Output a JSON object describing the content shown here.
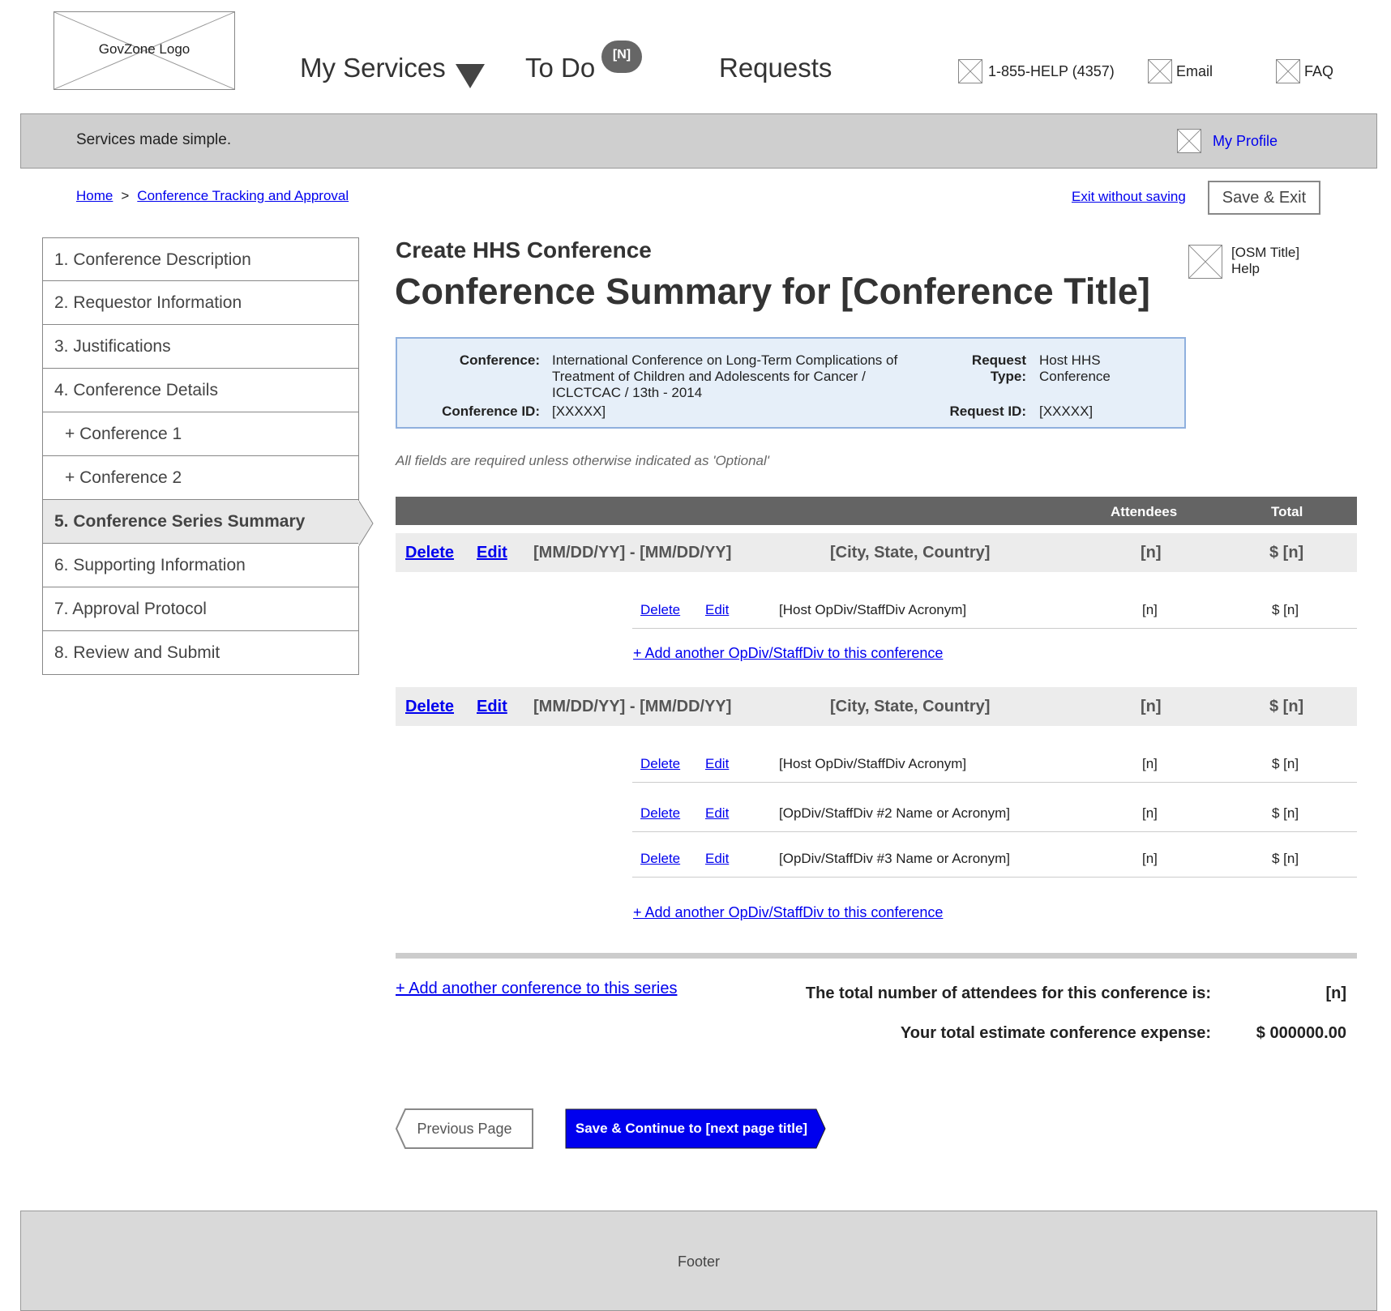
{
  "header": {
    "logo_text": "GovZone Logo",
    "nav": {
      "my_services": "My Services",
      "to_do": "To Do",
      "to_do_badge": "[N]",
      "requests": "Requests"
    },
    "utilities": {
      "phone": "1-855-HELP (4357)",
      "email": "Email",
      "faq": "FAQ"
    },
    "tagline": "Services made simple.",
    "my_profile": "My Profile"
  },
  "breadcrumb": {
    "home": "Home",
    "separator": ">",
    "current": "Conference Tracking and Approval"
  },
  "actions": {
    "exit_without_saving": "Exit without saving",
    "save_exit": "Save & Exit"
  },
  "sidebar": {
    "items": [
      {
        "label": "1. Conference Description"
      },
      {
        "label": "2. Requestor Information"
      },
      {
        "label": "3. Justifications"
      },
      {
        "label": "4. Conference Details"
      },
      {
        "label": "+ Conference 1"
      },
      {
        "label": "+ Conference 2"
      },
      {
        "label": "5. Conference Series Summary"
      },
      {
        "label": "6. Supporting Information"
      },
      {
        "label": "7. Approval Protocol"
      },
      {
        "label": "8. Review and Submit"
      }
    ]
  },
  "page": {
    "subtitle": "Create HHS Conference",
    "title": "Conference Summary for [Conference Title]",
    "help_line1": "[OSM Title]",
    "help_line2": "Help"
  },
  "info": {
    "conference_label": "Conference:",
    "conference_value": "International Conference on Long-Term Complications of Treatment of Children and Adolescents for Cancer / ICLCTCAC / 13th - 2014",
    "conference_id_label": "Conference ID:",
    "conference_id_value": "[XXXXX]",
    "request_type_label_1": "Request",
    "request_type_label_2": "Type:",
    "request_type_value_1": "Host HHS",
    "request_type_value_2": "Conference",
    "request_id_label": "Request ID:",
    "request_id_value": "[XXXXX]"
  },
  "note": "All fields are required unless otherwise indicated as 'Optional'",
  "table": {
    "col_attendees": "Attendees",
    "col_total": "Total",
    "delete": "Delete",
    "edit": "Edit",
    "conferences": [
      {
        "dates": "[MM/DD/YY] - [MM/DD/YY]",
        "location": "[City, State, Country]",
        "attendees": "[n]",
        "total": "$ [n]",
        "divisions": [
          {
            "name": "[Host OpDiv/StaffDiv Acronym]",
            "attendees": "[n]",
            "total": "$ [n]"
          }
        ]
      },
      {
        "dates": "[MM/DD/YY] - [MM/DD/YY]",
        "location": "[City, State, Country]",
        "attendees": "[n]",
        "total": "$ [n]",
        "divisions": [
          {
            "name": "[Host OpDiv/StaffDiv Acronym]",
            "attendees": "[n]",
            "total": "$ [n]"
          },
          {
            "name": "[OpDiv/StaffDiv #2 Name or Acronym]",
            "attendees": "[n]",
            "total": "$ [n]"
          },
          {
            "name": "[OpDiv/StaffDiv #3 Name or Acronym]",
            "attendees": "[n]",
            "total": "$ [n]"
          }
        ]
      }
    ],
    "add_division": "+ Add another OpDiv/StaffDiv to this conference"
  },
  "summary": {
    "add_conference": "+ Add another conference to this series",
    "attendees_label": "The total number of attendees for this conference is:",
    "attendees_value": "[n]",
    "expense_label": "Your total estimate conference expense:",
    "expense_value": "$ 000000.00"
  },
  "buttons": {
    "previous": "Previous Page",
    "next": "Save & Continue to [next page title]"
  },
  "footer": {
    "text": "Footer"
  },
  "colors": {
    "link": "#0000ee",
    "primary_button": "#0000ee",
    "table_header": "#646464",
    "info_panel": "#e6eff9"
  }
}
